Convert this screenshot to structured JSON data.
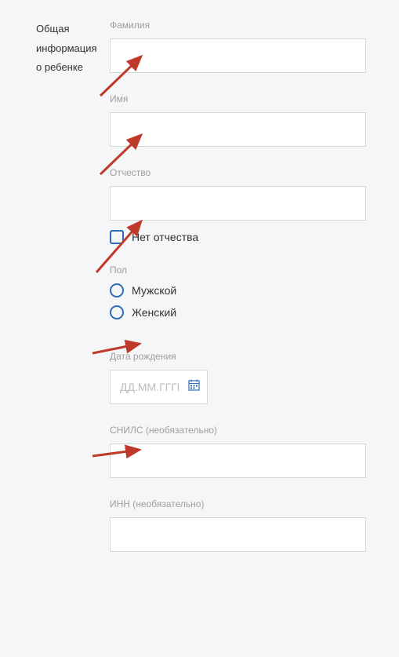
{
  "sidebar": {
    "title_line1": "Общая",
    "title_line2": "информация",
    "title_line3": "о ребенке"
  },
  "fields": {
    "surname": {
      "label": "Фамилия",
      "value": ""
    },
    "name": {
      "label": "Имя",
      "value": ""
    },
    "patronymic": {
      "label": "Отчество",
      "value": "",
      "no_patronymic_label": "Нет отчества"
    },
    "gender": {
      "label": "Пол",
      "options": {
        "male": "Мужской",
        "female": "Женский"
      }
    },
    "birthdate": {
      "label": "Дата рождения",
      "placeholder": "ДД.ММ.ГГГГ"
    },
    "snils": {
      "label": "СНИЛС (необязательно)",
      "value": ""
    },
    "inn": {
      "label": "ИНН (необязательно)",
      "value": ""
    }
  },
  "annotations": {
    "arrow_color": "#C03A2B"
  }
}
